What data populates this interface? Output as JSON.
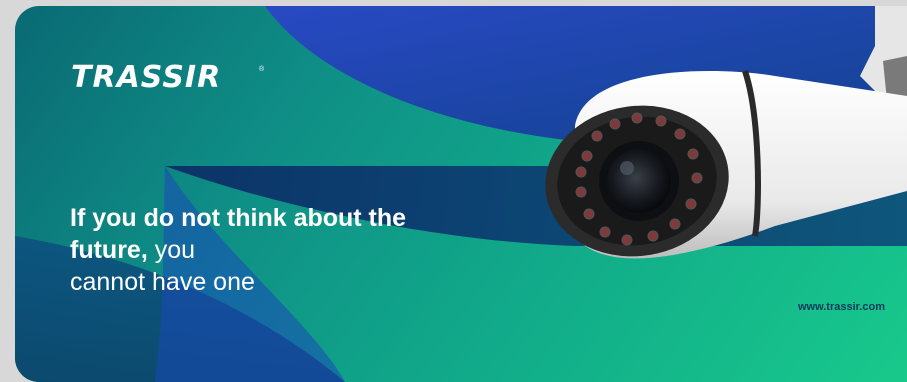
{
  "brand": {
    "logo_text": "TRASSIR",
    "logo_mark": "®"
  },
  "tagline": {
    "bold_part": "If you do not think about the future,",
    "regular_part_1": " you",
    "regular_part_2": "cannot have one"
  },
  "footer": {
    "url": "www.trassir.com"
  },
  "image": {
    "subject": "bullet-security-camera"
  },
  "colors": {
    "background_teal": "#11a98a",
    "background_green": "#18c98b",
    "shape_blue": "#1e4fb8",
    "shape_navy": "#0d2f6b",
    "url_text": "#0a3a5a",
    "text": "#ffffff"
  }
}
